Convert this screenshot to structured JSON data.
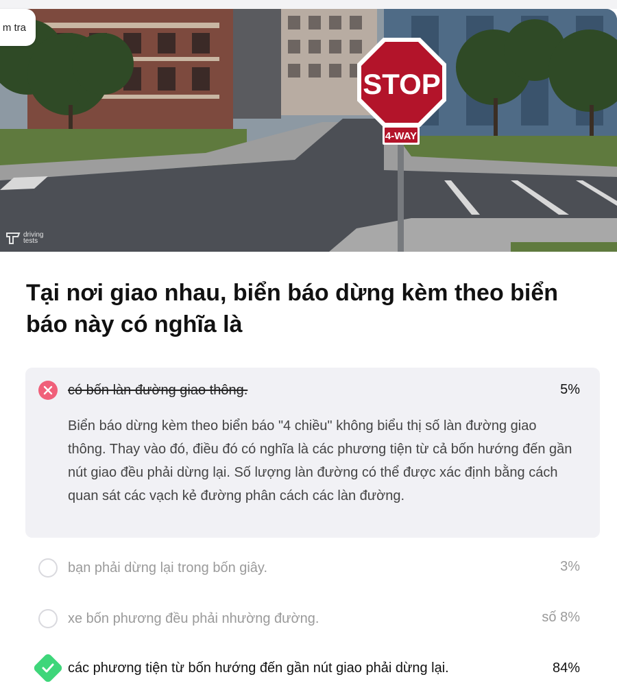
{
  "header": {
    "tab_label": "m tra"
  },
  "hero": {
    "sign_text": "STOP",
    "plate_text": "4-WAY",
    "watermark_line1": "driving",
    "watermark_line2": "tests",
    "colors": {
      "sign_red": "#b3142a",
      "sky": "#9aa7b2",
      "road": "#4c4f55"
    }
  },
  "question": {
    "text": "Tại nơi giao nhau, biển báo dừng kèm theo biển báo này có nghĩa là"
  },
  "options": [
    {
      "state": "wrong",
      "text": "có bốn làn đường giao thông.",
      "percent": "5%",
      "explanation": "Biển báo dừng kèm theo biển báo \"4 chiều\" không biểu thị số làn đường giao thông. Thay vào đó, điều đó có nghĩa là các phương tiện từ cả bốn hướng đến gần nút giao đều phải dừng lại. Số lượng làn đường có thể được xác định bằng cách quan sát các vạch kẻ đường phân cách các làn đường.",
      "icon": "x-circle-icon"
    },
    {
      "state": "unselected",
      "text": "bạn phải dừng lại trong bốn giây.",
      "percent": "3%",
      "icon": "empty-circle-icon"
    },
    {
      "state": "unselected",
      "text": "xe bốn phương đều phải nhường đường.",
      "percent": "số 8%",
      "icon": "empty-circle-icon"
    },
    {
      "state": "correct",
      "text": "các phương tiện từ bốn hướng đến gần nút giao phải dừng lại.",
      "percent": "84%",
      "icon": "check-icon"
    }
  ],
  "colors": {
    "wrong": "#f0607a",
    "correct": "#3ed67a",
    "expanded_bg": "#f1f1f5"
  }
}
